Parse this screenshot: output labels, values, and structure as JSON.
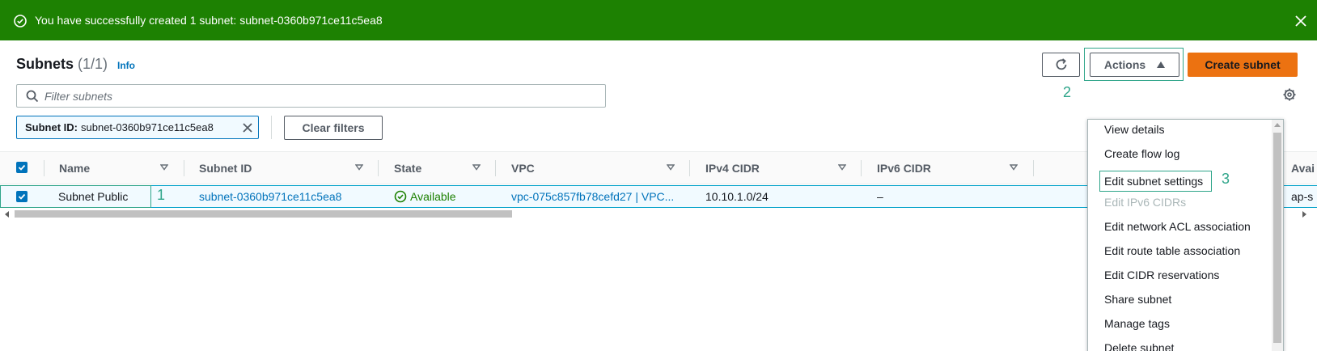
{
  "banner": {
    "message": "You have successfully created 1 subnet: subnet-0360b971ce11c5ea8",
    "background": "#1d8102"
  },
  "header": {
    "title": "Subnets",
    "count": "(1/1)",
    "info_link": "Info"
  },
  "toolbar": {
    "actions_label": "Actions",
    "create_label": "Create subnet",
    "create_color": "#ec7211"
  },
  "search": {
    "placeholder": "Filter subnets",
    "value": ""
  },
  "filter_token": {
    "key": "Subnet ID:",
    "value": "subnet-0360b971ce11c5ea8"
  },
  "clear_filters_label": "Clear filters",
  "table": {
    "columns": [
      "Name",
      "Subnet ID",
      "State",
      "VPC",
      "IPv4 CIDR",
      "IPv6 CIDR",
      "Avai"
    ],
    "rows": [
      {
        "name": "Subnet Public",
        "subnet_id": "subnet-0360b971ce11c5ea8",
        "state": "Available",
        "vpc": "vpc-075c857fb78cefd27 | VPC...",
        "ipv4_cidr": "10.10.1.0/24",
        "ipv6_cidr": "–",
        "availability": "ap-s"
      }
    ]
  },
  "actions_menu": {
    "items": [
      {
        "label": "View details",
        "disabled": false
      },
      {
        "label": "Create flow log",
        "disabled": false
      },
      {
        "label": "Edit subnet settings",
        "disabled": false
      },
      {
        "label": "Edit IPv6 CIDRs",
        "disabled": true
      },
      {
        "label": "Edit network ACL association",
        "disabled": false
      },
      {
        "label": "Edit route table association",
        "disabled": false
      },
      {
        "label": "Edit CIDR reservations",
        "disabled": false
      },
      {
        "label": "Share subnet",
        "disabled": false
      },
      {
        "label": "Manage tags",
        "disabled": false
      },
      {
        "label": "Delete subnet",
        "disabled": false
      }
    ]
  },
  "annotations": {
    "step1": "1",
    "step2": "2",
    "step3": "3",
    "color": "#2fa58a"
  },
  "icons": {
    "banner": "check-circle-icon",
    "close": "close-icon",
    "refresh": "refresh-icon",
    "search": "search-icon",
    "settings": "gear-icon",
    "sort": "caret-down-icon"
  }
}
